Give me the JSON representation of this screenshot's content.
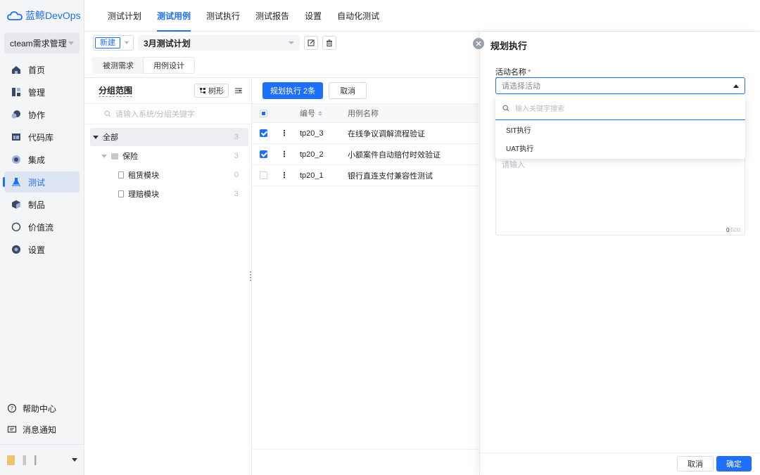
{
  "app": {
    "brand": "蓝鲸DevOps"
  },
  "sidebar": {
    "project": "cteam需求管理",
    "items": [
      {
        "label": "首页",
        "icon": "home-icon"
      },
      {
        "label": "管理",
        "icon": "manage-icon"
      },
      {
        "label": "协作",
        "icon": "collab-icon"
      },
      {
        "label": "代码库",
        "icon": "repo-icon"
      },
      {
        "label": "集成",
        "icon": "integration-icon"
      },
      {
        "label": "测试",
        "icon": "test-icon",
        "active": true
      },
      {
        "label": "制品",
        "icon": "artifact-icon"
      },
      {
        "label": "价值流",
        "icon": "valuestream-icon"
      },
      {
        "label": "设置",
        "icon": "settings-icon"
      }
    ],
    "bottom": [
      {
        "label": "帮助中心",
        "icon": "help-icon"
      },
      {
        "label": "消息通知",
        "icon": "message-icon"
      }
    ]
  },
  "topnav": {
    "tabs": [
      {
        "label": "测试计划"
      },
      {
        "label": "测试用例",
        "active": true
      },
      {
        "label": "测试执行"
      },
      {
        "label": "测试报告"
      },
      {
        "label": "设置"
      },
      {
        "label": "自动化测试"
      }
    ]
  },
  "toolbar": {
    "new_label": "新建",
    "plan": "3月测试计划"
  },
  "subtabs": [
    {
      "label": "被测需求"
    },
    {
      "label": "用例设计",
      "active": true
    }
  ],
  "group": {
    "title": "分组范围",
    "tree_btn": "树形",
    "search_placeholder": "请输入系统/分组关键字",
    "tree": [
      {
        "label": "全部",
        "count": "3"
      },
      {
        "label": "保险",
        "count": "3"
      },
      {
        "label": "租赁模块",
        "count": "0"
      },
      {
        "label": "理赔模块",
        "count": "3"
      }
    ]
  },
  "cases": {
    "plan_btn": "规划执行 2条",
    "cancel_btn": "取消",
    "columns": {
      "id": "编号",
      "name": "用例名称"
    },
    "rows": [
      {
        "id": "tp20_3",
        "name": "在线争议调解流程验证",
        "checked": true
      },
      {
        "id": "tp20_2",
        "name": "小额案件自动赔付时效验证",
        "checked": true
      },
      {
        "id": "tp20_1",
        "name": "银行直连支付兼容性测试",
        "checked": false
      }
    ]
  },
  "drawer": {
    "title": "规划执行",
    "field_label": "活动名称",
    "required_mark": "*",
    "select_placeholder": "请选择活动",
    "search_placeholder": "输入关键字搜索",
    "options": [
      "SIT执行",
      "UAT执行"
    ],
    "textarea_placeholder": "请输入",
    "counter_current": "0",
    "counter_max": "/500",
    "cancel": "取消",
    "confirm": "确定"
  },
  "colors": {
    "accent": "#1e6fff",
    "required": "#e64545"
  }
}
